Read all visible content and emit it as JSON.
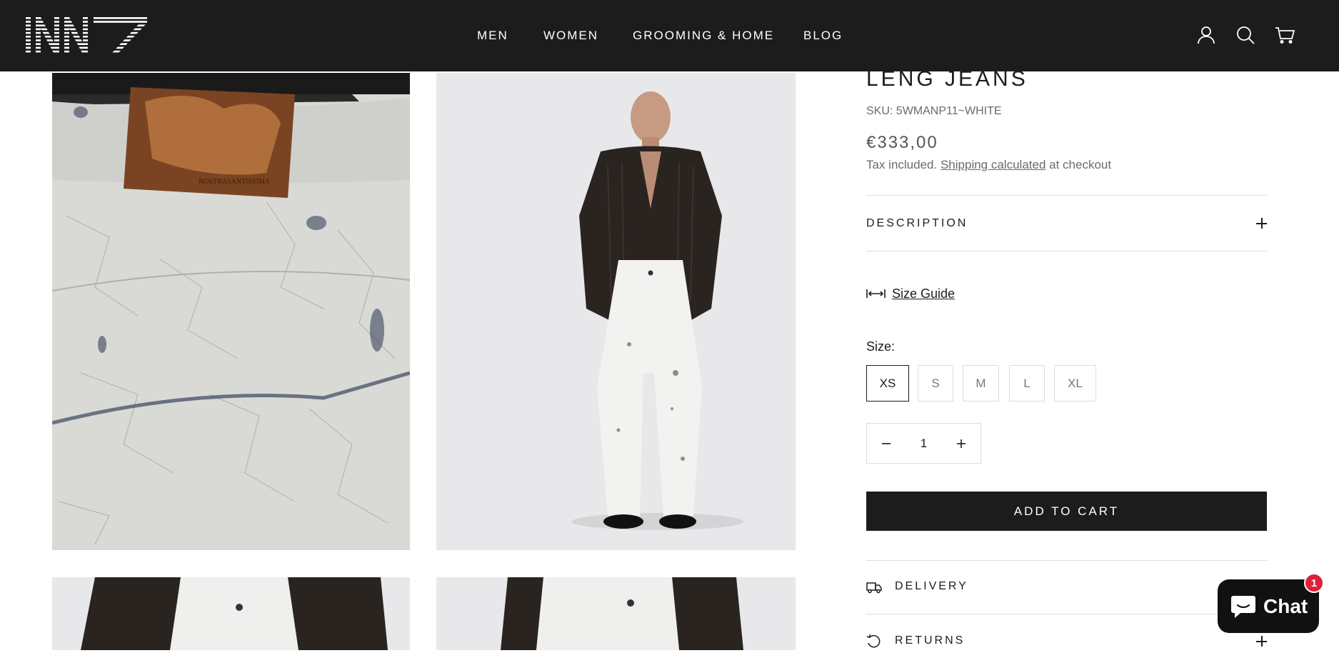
{
  "header": {
    "logo_text": "INN7",
    "nav": [
      {
        "label": "MEN"
      },
      {
        "label": "WOMEN"
      },
      {
        "label": "GROOMING & HOME"
      },
      {
        "label": "BLOG"
      }
    ],
    "icons": [
      "account-icon",
      "search-icon",
      "cart-icon"
    ]
  },
  "gallery": {
    "images": [
      "jeans-back-pocket-closeup",
      "model-full-front",
      "model-waist-front",
      "model-waist-closeup"
    ],
    "patch_text": "NOSTRASANTISSIMA"
  },
  "product": {
    "title": "LENG JEANS",
    "sku": "SKU: 5WMANP11~WHITE",
    "price": "€333,00",
    "tax_prefix": "Tax included.",
    "shipping_link": "Shipping calculated",
    "tax_suffix": "at checkout",
    "description_label": "DESCRIPTION",
    "size_guide_label": "Size Guide",
    "size_label": "Size:",
    "sizes": [
      {
        "label": "XS",
        "selected": true
      },
      {
        "label": "S",
        "selected": false
      },
      {
        "label": "M",
        "selected": false
      },
      {
        "label": "L",
        "selected": false
      },
      {
        "label": "XL",
        "selected": false
      }
    ],
    "quantity": "1",
    "add_to_cart_label": "ADD TO CART",
    "delivery_label": "DELIVERY",
    "returns_label": "RETURNS"
  },
  "chat": {
    "label": "Chat",
    "badge_count": "1"
  },
  "colors": {
    "header_bg": "#1c1c1c",
    "button_bg": "#1c1c1c",
    "badge": "#e0203b"
  }
}
